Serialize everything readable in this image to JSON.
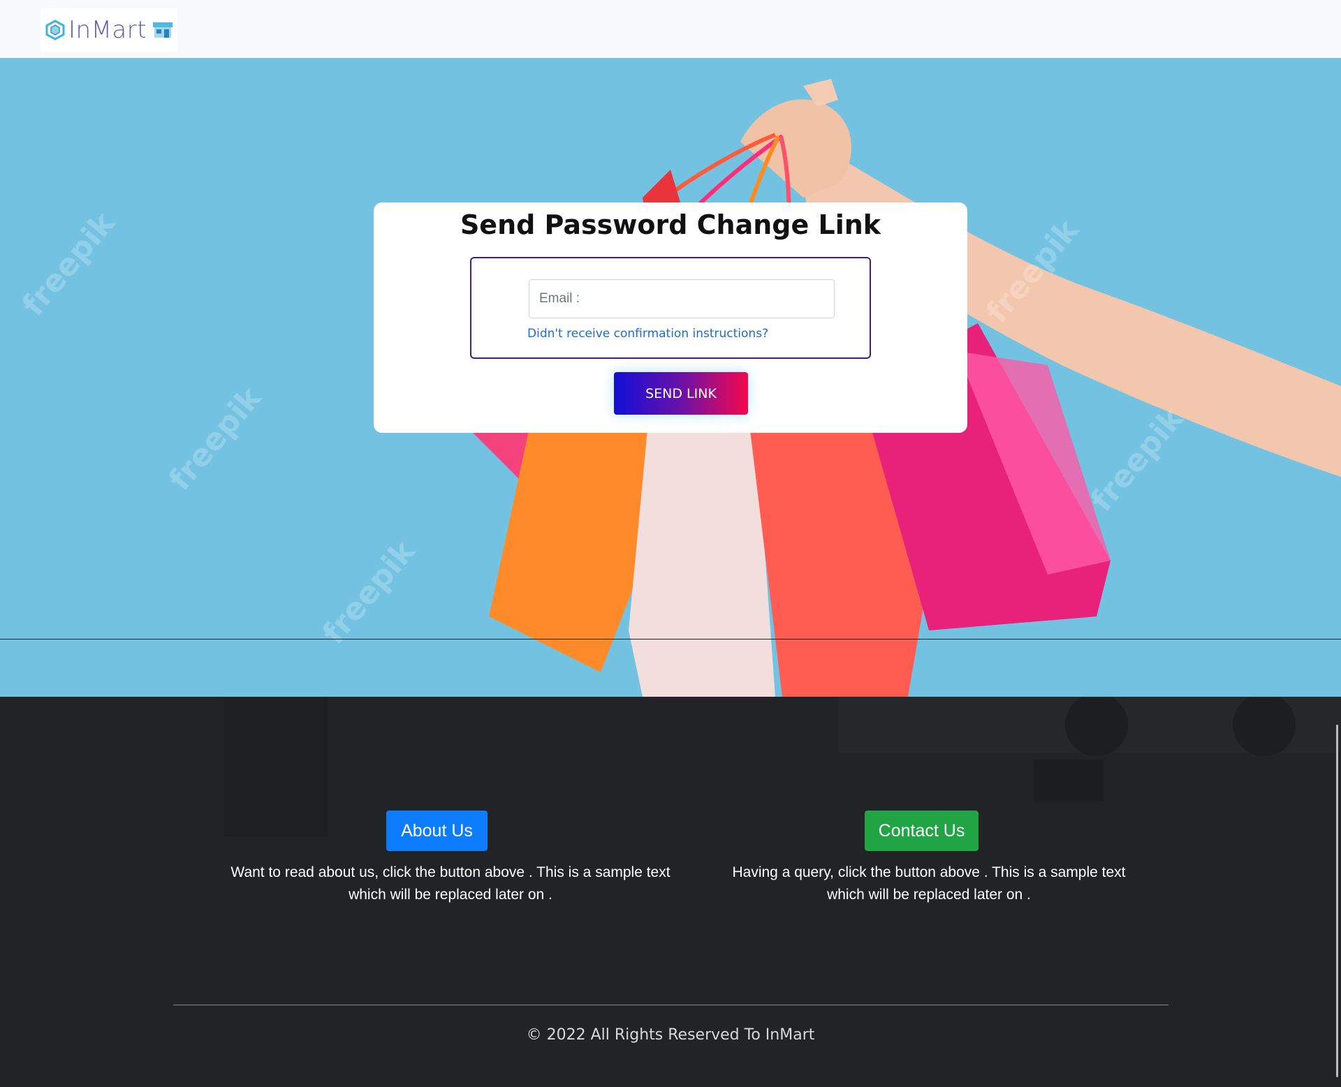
{
  "header": {
    "brand_name": "InMart",
    "brand_icon": "cube-icon",
    "store_icon": "store-icon"
  },
  "hero": {
    "watermark": "freepik"
  },
  "card": {
    "title": "Send Password Change Link",
    "email_placeholder": "Email :",
    "email_value": "",
    "confirm_link": "Didn't receive confirmation instructions?",
    "send_button": "SEND LINK"
  },
  "footer": {
    "about_button": "About Us",
    "about_text": "Want to read about us, click the button above . This is a sample text which will be replaced later on .",
    "contact_button": "Contact Us",
    "contact_text": "Having a query, click the button above . This is a sample text which will be replaced later on .",
    "copyright": "© 2022 All Rights Reserved To InMart"
  },
  "colors": {
    "hero_bg": "#74c2e2",
    "about_button": "#0d7cff",
    "contact_button": "#21a444",
    "send_gradient_start": "#120fd6",
    "send_gradient_end": "#f5084d",
    "form_border": "#4b1a8a",
    "footer_bg": "#222326"
  }
}
